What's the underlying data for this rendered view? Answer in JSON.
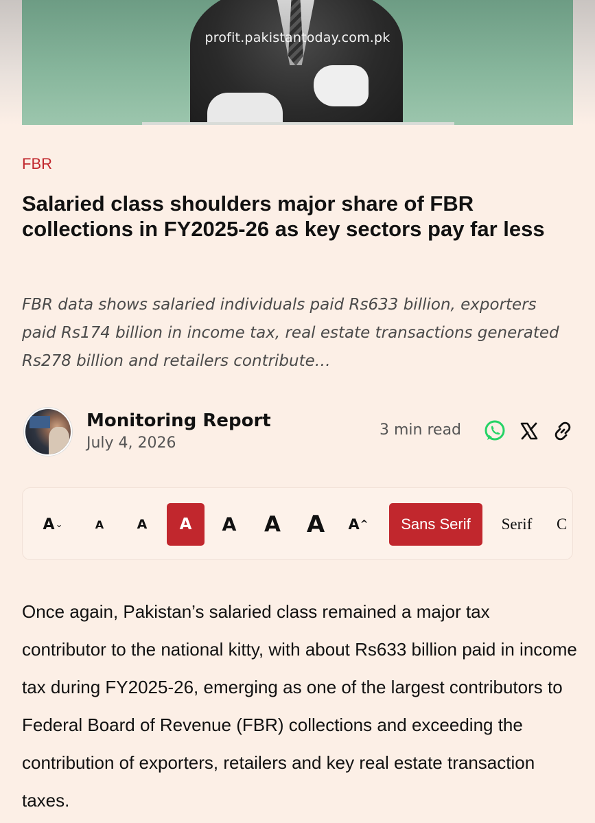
{
  "hero": {
    "watermark": "profit.pakistantoday.com.pk"
  },
  "article": {
    "category": "FBR",
    "headline": "Salaried class shoulders major share of FBR collections in FY2025-26 as key sectors pay far less",
    "dek": "FBR data shows salaried individuals paid Rs633 billion, exporters paid Rs174 billion in income tax, real estate transactions generated Rs278 billion and retailers contribute…",
    "author": "Monitoring Report",
    "date": "July 4, 2026",
    "read_time": "3 min read",
    "body": "Once again, Pakistan’s salaried class remained a major tax contributor to the national kitty, with about Rs633 billion paid in income tax during FY2025-26, emerging as one of the largest contributors to Federal Board of Revenue (FBR) collections and exceeding the contribution of exporters, retailers and key real estate transaction taxes."
  },
  "share": {
    "icons": [
      "whatsapp-icon",
      "x-icon",
      "link-icon"
    ],
    "whatsapp_color": "#25d366"
  },
  "toolbar": {
    "decrease_label": "A",
    "increase_label": "A",
    "sizes": [
      "A",
      "A",
      "A",
      "A",
      "A",
      "A"
    ],
    "active_size_index": 2,
    "fonts": [
      "Sans Serif",
      "Serif",
      "C"
    ],
    "active_font": "Sans Serif",
    "accent_color": "#c1272d"
  },
  "colors": {
    "background": "#fcefe6",
    "accent": "#c1272d"
  }
}
